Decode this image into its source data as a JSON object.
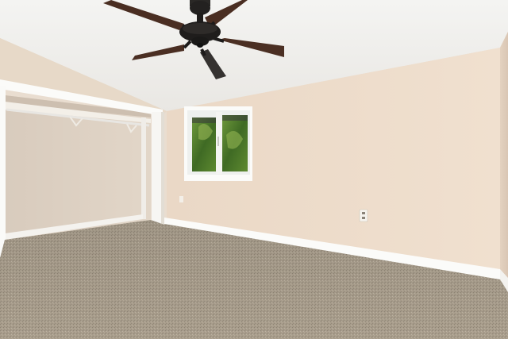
{
  "scene": {
    "subject": "empty-bedroom",
    "objects": [
      "ceiling-fan",
      "window",
      "open-closet",
      "closet-rod",
      "baseboard",
      "electrical-outlet",
      "carpet-floor"
    ],
    "colors": {
      "ceiling": "#f3f2ef",
      "wall": "#eddcca",
      "wall_shadow": "#e2cfbd",
      "closet_interior": "#ddd0c2",
      "trim": "#fbfbf9",
      "carpet": "#a59a89",
      "fan_body": "#1f1d1c",
      "fan_blade": "#4a2e22",
      "foliage": "#4f7a2c"
    }
  }
}
